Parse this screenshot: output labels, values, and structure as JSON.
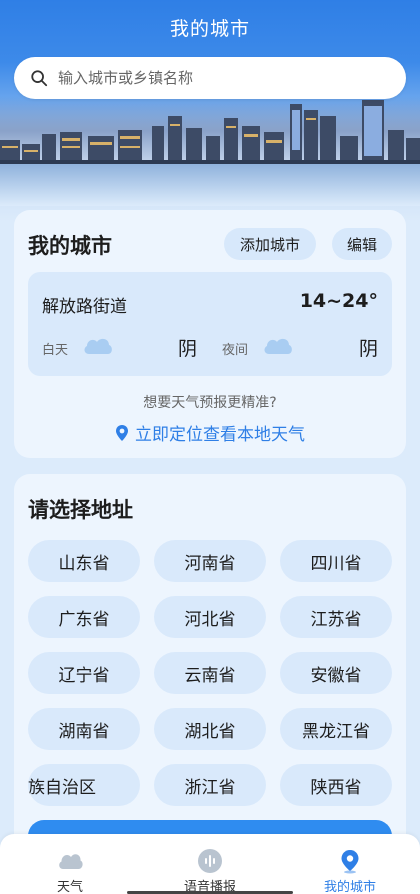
{
  "header": {
    "title": "我的城市"
  },
  "search": {
    "placeholder": "输入城市或乡镇名称"
  },
  "my_cities": {
    "title": "我的城市",
    "add_label": "添加城市",
    "edit_label": "编辑",
    "city": {
      "name": "解放路街道",
      "temp_range": "14~24°",
      "day_label": "白天",
      "day_condition": "阴",
      "night_label": "夜间",
      "night_condition": "阴"
    },
    "hint": "想要天气预报更精准?",
    "locate_label": "立即定位查看本地天气"
  },
  "address": {
    "title": "请选择地址",
    "provinces": [
      "山东省",
      "河南省",
      "四川省",
      "广东省",
      "河北省",
      "江苏省",
      "辽宁省",
      "云南省",
      "安徽省",
      "湖南省",
      "湖北省",
      "黑龙江省",
      "族自治区",
      "浙江省",
      "陕西省"
    ]
  },
  "tabs": [
    {
      "label": "天气",
      "icon": "cloud-icon",
      "active": false
    },
    {
      "label": "语音播报",
      "icon": "voice-icon",
      "active": false
    },
    {
      "label": "我的城市",
      "icon": "location-pin-icon",
      "active": true
    }
  ],
  "colors": {
    "accent": "#2f7fe6",
    "card": "#edf5fe",
    "pill": "#d9e9fb"
  }
}
